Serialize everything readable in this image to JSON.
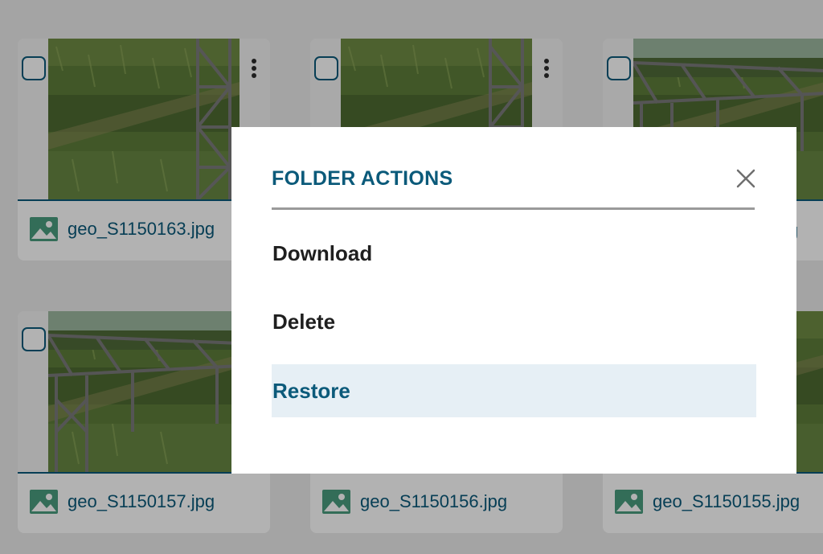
{
  "grid": {
    "files": [
      {
        "name": ""
      },
      {
        "name": ""
      },
      {
        "name": ""
      },
      {
        "name": "geo_S1150157.jpg"
      },
      {
        "name": "geo_S1150156.jpg"
      },
      {
        "name": "geo_S1150155.jpg"
      }
    ],
    "visible_name_fragments": [
      "geo_S1150163.jpg",
      "g"
    ]
  },
  "modal": {
    "title": "FOLDER ACTIONS",
    "items": [
      {
        "label": "Download"
      },
      {
        "label": "Delete"
      },
      {
        "label": "Restore",
        "highlighted": true
      }
    ]
  },
  "colors": {
    "accent": "#0b5a7a",
    "highlight": "#e6eff5",
    "overlay": "rgba(0,0,0,0.30)",
    "text": "#1f1f1f",
    "file_icon": "#4a9c7e"
  },
  "icons": [
    "checkbox-icon",
    "more-vertical-icon",
    "image-file-icon",
    "close-icon"
  ]
}
